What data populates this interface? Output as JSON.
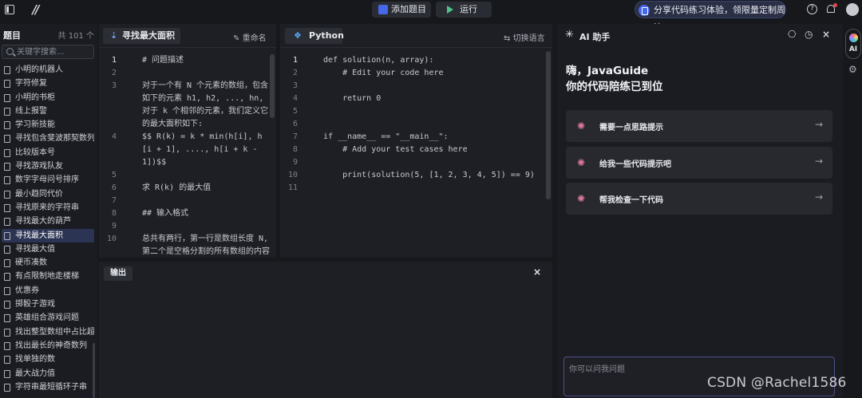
{
  "topbar": {
    "add_problem": "添加题目",
    "run": "运行",
    "banner": "分享代码练习体验，领限量定制周边"
  },
  "sidebar": {
    "title": "题目",
    "count": "共 101 个",
    "search_placeholder": "关键字搜索...",
    "items": [
      "小明的机器人",
      "字符修复",
      "小明的书柜",
      "线上报警",
      "学习新技能",
      "寻找包含斐波那契数列的最长子序列",
      "比较版本号",
      "寻找游戏队友",
      "数字字母问号排序",
      "最小趋同代价",
      "寻找原来的字符串",
      "寻找最大的葫芦",
      "寻找最大面积",
      "寻找最大值",
      "硬币凑数",
      "有点限制地走楼梯",
      "优惠券",
      "掷骰子游戏",
      "英雄组合游戏问题",
      "找出整型数组中占比超过一半的数",
      "找出最长的神奇数列",
      "找单独的数",
      "最大战力值",
      "字符串最短循环子串"
    ],
    "active_index": 12
  },
  "left_editor": {
    "tab_label": "寻找最大面积",
    "rename": "重命名",
    "lines": [
      {
        "n": "1",
        "t": "# 问题描述"
      },
      {
        "n": "2",
        "t": ""
      },
      {
        "n": "3",
        "t": "对于一个有 N 个元素的数组，包含"
      },
      {
        "n": "",
        "t": "如下的元素 h1, h2, ..., hn,"
      },
      {
        "n": "",
        "t": "对于 k 个相邻的元素，我们定义它"
      },
      {
        "n": "",
        "t": "的最大面积如下:"
      },
      {
        "n": "4",
        "t": "$$ R(k) = k * min(h[i], h"
      },
      {
        "n": "",
        "t": "[i + 1], ...., h[i + k -"
      },
      {
        "n": "",
        "t": "1])$$"
      },
      {
        "n": "5",
        "t": ""
      },
      {
        "n": "6",
        "t": "求 R(k) 的最大值"
      },
      {
        "n": "7",
        "t": ""
      },
      {
        "n": "8",
        "t": "## 输入格式"
      },
      {
        "n": "9",
        "t": ""
      },
      {
        "n": "10",
        "t": "总共有两行，第一行是数组长度 N,"
      },
      {
        "n": "",
        "t": "第二个是空格分割的所有数组的内容"
      }
    ]
  },
  "right_editor": {
    "tab_label": "Python",
    "switch_lang": "切换语言",
    "lines": [
      {
        "n": "1",
        "t": "def solution(n, array):"
      },
      {
        "n": "2",
        "t": "    # Edit your code here"
      },
      {
        "n": "3",
        "t": ""
      },
      {
        "n": "4",
        "t": "    return 0"
      },
      {
        "n": "5",
        "t": ""
      },
      {
        "n": "6",
        "t": ""
      },
      {
        "n": "7",
        "t": "if __name__ == \"__main__\":"
      },
      {
        "n": "8",
        "t": "    # Add your test cases here"
      },
      {
        "n": "9",
        "t": ""
      },
      {
        "n": "10",
        "t": "    print(solution(5, [1, 2, 3, 4, 5]) == 9)"
      },
      {
        "n": "11",
        "t": ""
      }
    ]
  },
  "output": {
    "label": "输出",
    "close": "×"
  },
  "ai": {
    "title": "AI 助手",
    "greeting_line1": "嗨，JavaGuide",
    "greeting_line2": "你的代码陪练已到位",
    "suggestions": [
      "需要一点思路提示",
      "给我一些代码提示吧",
      "帮我检查一下代码"
    ],
    "input_placeholder": "你可以问我问题"
  },
  "rail": {
    "ai_label": "AI"
  },
  "watermark": "CSDN @Rachel1586"
}
